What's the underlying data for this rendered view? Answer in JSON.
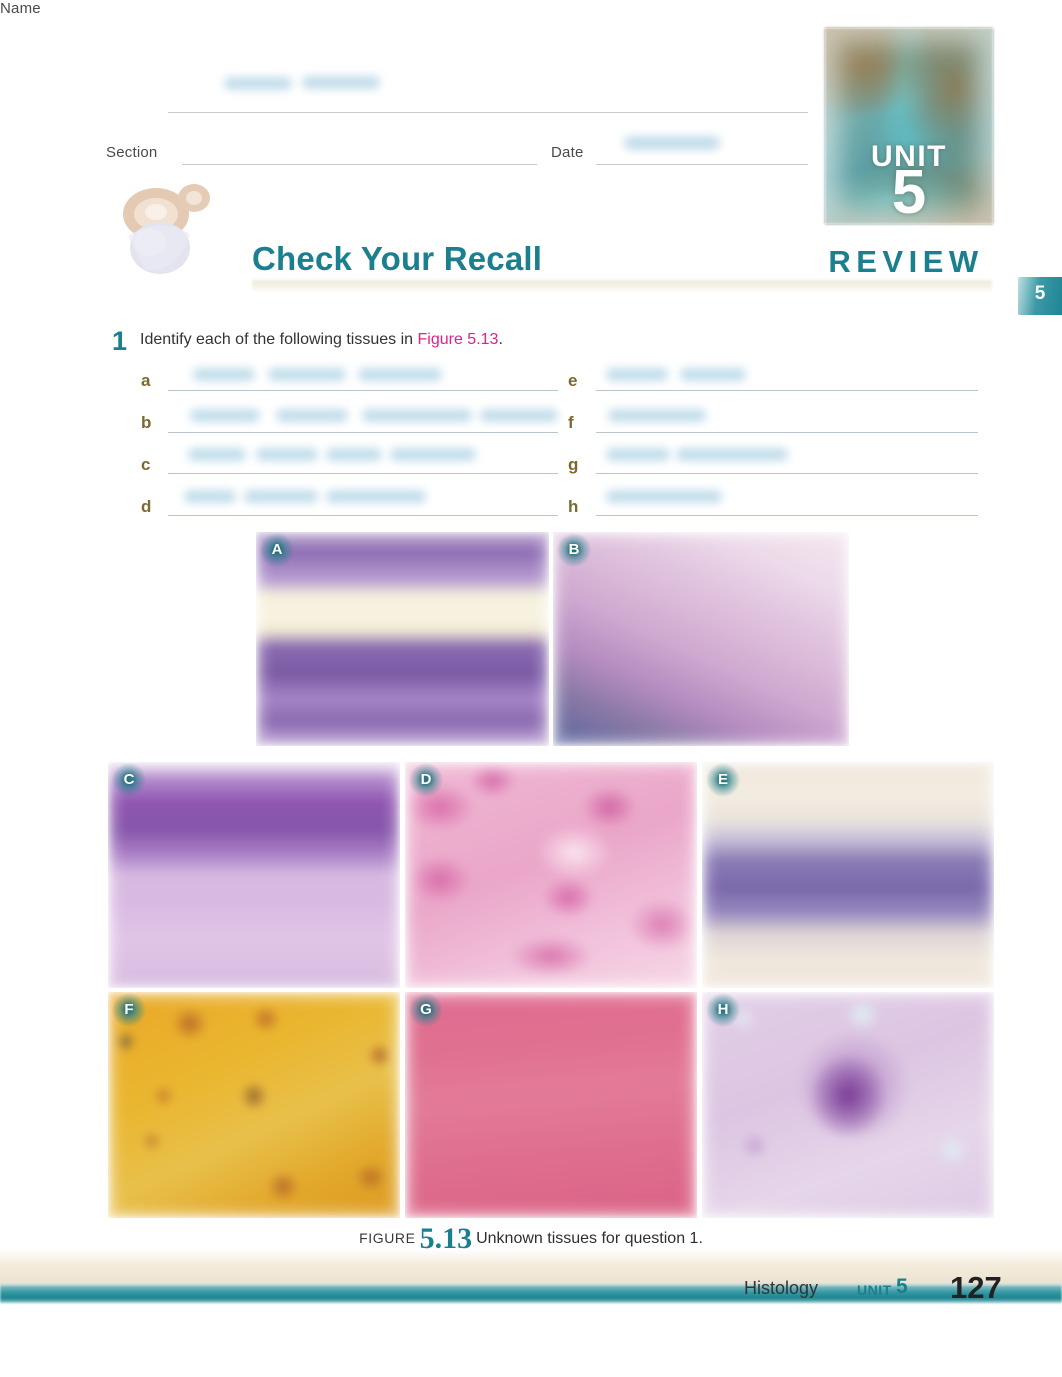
{
  "header": {
    "name_label": "Name",
    "section_label": "Section",
    "date_label": "Date",
    "name_value": "",
    "section_value": "",
    "date_value": ""
  },
  "unit_badge": {
    "unit_word": "UNIT",
    "unit_number": "5",
    "review_word": "REVIEW",
    "side_tab_number": "5",
    "accent_color": "#1a7f8e"
  },
  "section_heading": {
    "title": "Check Your Recall",
    "icon": "brain-head-icon"
  },
  "question": {
    "number": "1",
    "text_before": "Identify each of the following tissues in ",
    "figure_reference": "Figure 5.13",
    "text_after": ".",
    "figure_ref_color": "#e0218a",
    "answers": [
      {
        "letter": "a",
        "value": ""
      },
      {
        "letter": "b",
        "value": ""
      },
      {
        "letter": "c",
        "value": ""
      },
      {
        "letter": "d",
        "value": ""
      },
      {
        "letter": "e",
        "value": ""
      },
      {
        "letter": "f",
        "value": ""
      },
      {
        "letter": "g",
        "value": ""
      },
      {
        "letter": "h",
        "value": ""
      }
    ]
  },
  "figure": {
    "caption_word": "FIGURE",
    "caption_number": "5.13",
    "caption_text": "Unknown tissues for question 1.",
    "panels": [
      {
        "label": "A",
        "description": "purple-violet tissue with cream horizontal band"
      },
      {
        "label": "B",
        "description": "pale pink tissue with diagonal purple-blue band"
      },
      {
        "label": "C",
        "description": "dark purple band over pale mauve tissue"
      },
      {
        "label": "D",
        "description": "mottled pink tissue with magenta patches"
      },
      {
        "label": "E",
        "description": "red streaks, cream bands and violet regions"
      },
      {
        "label": "F",
        "description": "golden amber tissue with dark brown lacunae"
      },
      {
        "label": "G",
        "description": "uniform deep rose pink tissue"
      },
      {
        "label": "H",
        "description": "pale lavender tissue with large dark purple cell body"
      }
    ]
  },
  "footer": {
    "chapter": "Histology",
    "unit_label": "UNIT",
    "unit_number": "5",
    "page_number": "127"
  }
}
